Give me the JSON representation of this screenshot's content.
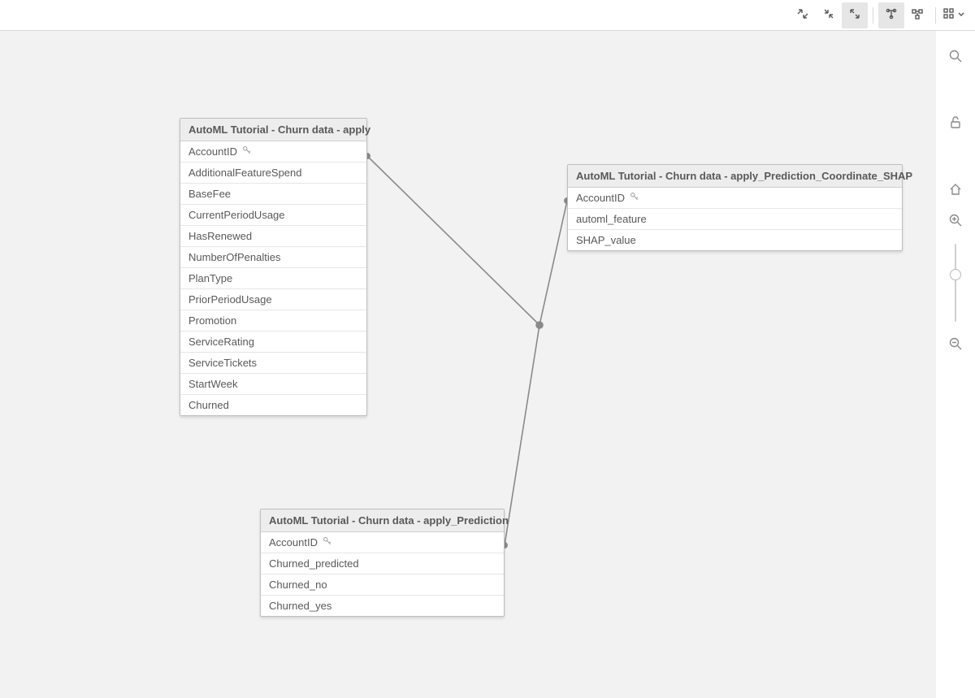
{
  "toolbar": {
    "btn_collapse": "collapse",
    "btn_reduce": "reduce",
    "btn_expand": "expand",
    "btn_layout_internal": "layout-internal",
    "btn_layout_external": "layout-external",
    "btn_grid": "grid-options"
  },
  "rail": {
    "search": "search",
    "lock": "lock",
    "home": "home",
    "zoom_in": "zoom-in",
    "zoom_out": "zoom-out"
  },
  "tables": {
    "t1": {
      "title": "AutoML Tutorial - Churn data - apply",
      "fields": [
        {
          "name": "AccountID",
          "key": true
        },
        {
          "name": "AdditionalFeatureSpend",
          "key": false
        },
        {
          "name": "BaseFee",
          "key": false
        },
        {
          "name": "CurrentPeriodUsage",
          "key": false
        },
        {
          "name": "HasRenewed",
          "key": false
        },
        {
          "name": "NumberOfPenalties",
          "key": false
        },
        {
          "name": "PlanType",
          "key": false
        },
        {
          "name": "PriorPeriodUsage",
          "key": false
        },
        {
          "name": "Promotion",
          "key": false
        },
        {
          "name": "ServiceRating",
          "key": false
        },
        {
          "name": "ServiceTickets",
          "key": false
        },
        {
          "name": "StartWeek",
          "key": false
        },
        {
          "name": "Churned",
          "key": false
        }
      ]
    },
    "t2": {
      "title": "AutoML Tutorial - Churn data - apply_Prediction_Coordinate_SHAP",
      "fields": [
        {
          "name": "AccountID",
          "key": true
        },
        {
          "name": "automl_feature",
          "key": false
        },
        {
          "name": "SHAP_value",
          "key": false
        }
      ]
    },
    "t3": {
      "title": "AutoML Tutorial - Churn data - apply_Prediction",
      "fields": [
        {
          "name": "AccountID",
          "key": true
        },
        {
          "name": "Churned_predicted",
          "key": false
        },
        {
          "name": "Churned_no",
          "key": false
        },
        {
          "name": "Churned_yes",
          "key": false
        }
      ]
    }
  }
}
